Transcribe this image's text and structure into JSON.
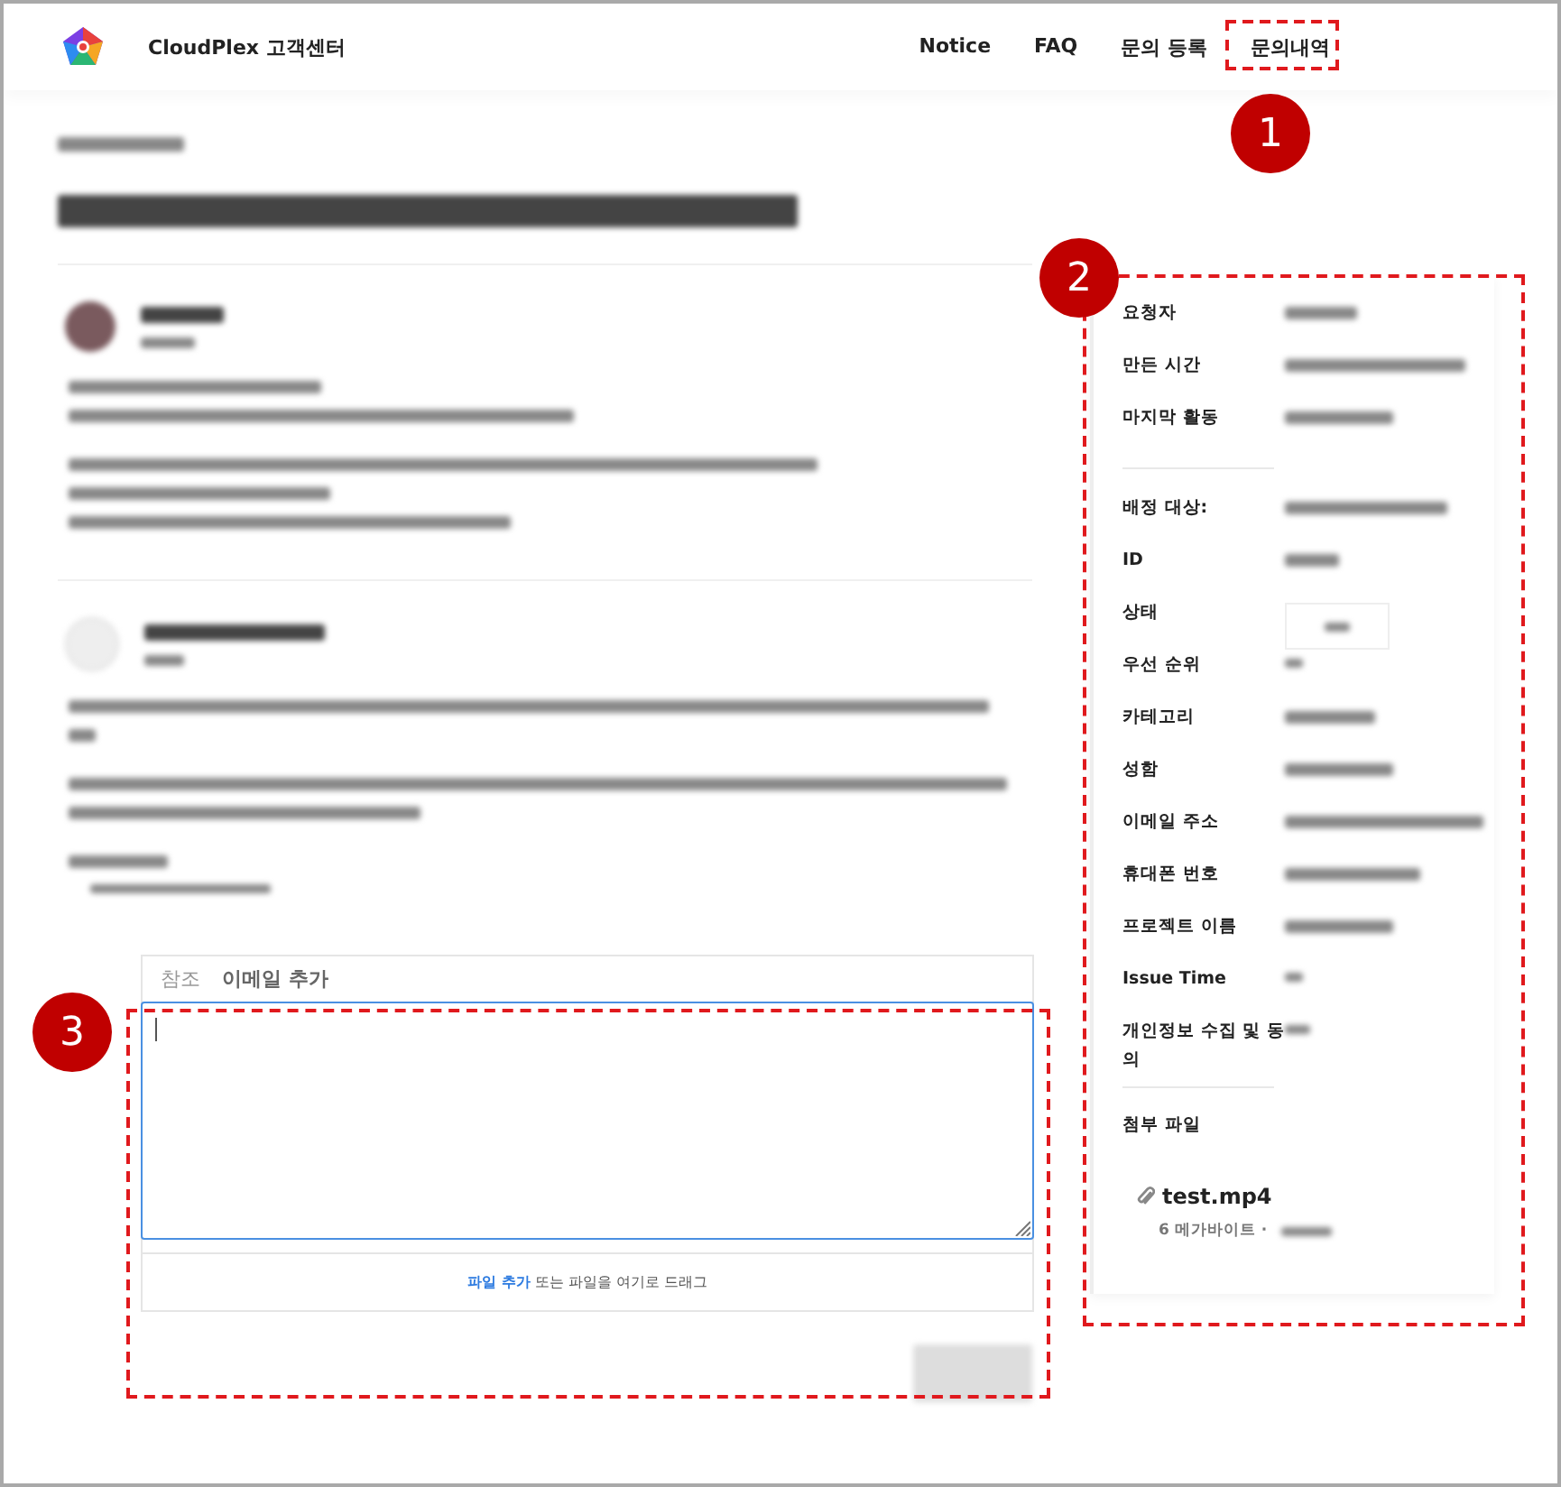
{
  "header": {
    "brand": "CloudPlex 고객센터",
    "nav": [
      {
        "label": "Notice"
      },
      {
        "label": "FAQ"
      },
      {
        "label": "문의 등록"
      },
      {
        "label": "문의내역"
      }
    ]
  },
  "sidebar": {
    "sections": [
      {
        "fields": [
          {
            "label": "요청자",
            "kind": "text"
          },
          {
            "label": "만든 시간",
            "kind": "text"
          },
          {
            "label": "마지막 활동",
            "kind": "text"
          }
        ]
      },
      {
        "fields": [
          {
            "label": "배정 대상:",
            "kind": "text"
          },
          {
            "label": "ID",
            "kind": "text"
          },
          {
            "label": "상태",
            "kind": "status"
          },
          {
            "label": "우선 순위",
            "kind": "mark"
          },
          {
            "label": "카테고리",
            "kind": "text"
          },
          {
            "label": "성함",
            "kind": "text"
          },
          {
            "label": "이메일 주소",
            "kind": "text"
          },
          {
            "label": "휴대폰 번호",
            "kind": "text"
          },
          {
            "label": "프로젝트 이름",
            "kind": "text"
          },
          {
            "label": "Issue Time",
            "kind": "mark"
          },
          {
            "label": "개인정보 수집 및 동의",
            "kind": "mark"
          }
        ]
      }
    ],
    "attachments": {
      "title": "첨부 파일",
      "files": [
        {
          "name": "test.mp4",
          "size": "6 메가바이트 ·"
        }
      ]
    }
  },
  "reply": {
    "cc_label": "참조",
    "cc_action": "이메일 추가",
    "drop_link": "파일 추가",
    "drop_text": "또는 파일을 여기로 드래그"
  },
  "annotations": [
    {
      "number": "1"
    },
    {
      "number": "2"
    },
    {
      "number": "3"
    }
  ]
}
